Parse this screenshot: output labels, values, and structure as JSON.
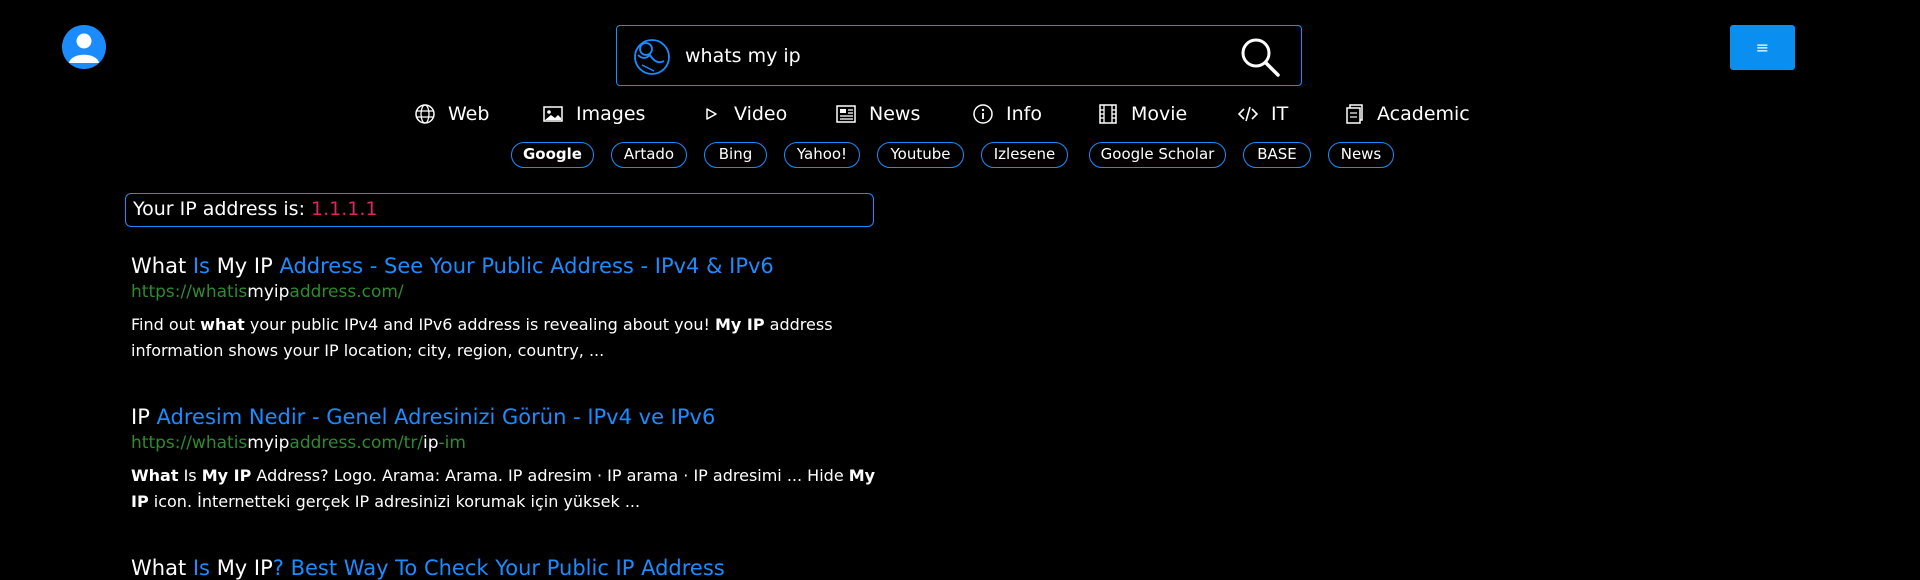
{
  "search": {
    "query": "whats my ip"
  },
  "menu_label": "≡",
  "tabs": [
    {
      "label": "Web",
      "icon": "globe-icon"
    },
    {
      "label": "Images",
      "icon": "image-icon"
    },
    {
      "label": "Video",
      "icon": "play-icon"
    },
    {
      "label": "News",
      "icon": "newspaper-icon"
    },
    {
      "label": "Info",
      "icon": "info-icon"
    },
    {
      "label": "Movie",
      "icon": "film-icon"
    },
    {
      "label": "IT",
      "icon": "code-icon"
    },
    {
      "label": "Academic",
      "icon": "notebook-icon"
    }
  ],
  "engines": [
    {
      "label": "Google",
      "active": true
    },
    {
      "label": "Artado"
    },
    {
      "label": "Bing"
    },
    {
      "label": "Yahoo!"
    },
    {
      "label": "Youtube"
    },
    {
      "label": "Izlesene"
    },
    {
      "label": "Google Scholar"
    },
    {
      "label": "BASE"
    },
    {
      "label": "News"
    }
  ],
  "ip_answer": {
    "label": "Your IP address is:",
    "value": "1.1.1.1"
  },
  "results": [
    {
      "title": {
        "w1": "What",
        "s1": " Is ",
        "w2": "My IP",
        "s2": " Address - See Your Public Address - IPv4 & IPv6"
      },
      "url": {
        "p1": "https://whatis",
        "p2": "myip",
        "p3": "address.com/"
      },
      "snippet": {
        "t1": "Find out ",
        "b1": "what",
        "t2": " your public IPv4 and IPv6 address is revealing about you! ",
        "b2": "My IP",
        "t3": " address information shows your IP location; city, region, country, ..."
      }
    },
    {
      "title": {
        "w1": "IP",
        "s1": " Adresim Nedir - Genel Adresinizi Görün - IPv4 ve IPv6"
      },
      "url": {
        "p1": "https://whatis",
        "p2": "myip",
        "p3": "address.com/tr/",
        "p4": "ip",
        "p5": "-im"
      },
      "snippet": {
        "b1": "What",
        "t1": " Is ",
        "b2": "My IP",
        "t2": " Address? Logo. Arama: Arama. IP adresim · IP arama · IP adresimi ... Hide ",
        "b3": "My IP",
        "t3": " icon. İnternetteki gerçek IP adresinizi korumak için yüksek ..."
      }
    },
    {
      "title": {
        "w1": "What",
        "s1": " Is ",
        "w2": "My IP",
        "s2": "? Best Way To Check Your Public IP Address"
      }
    }
  ],
  "colors": {
    "accent": "#1a8cff",
    "menu_button": "#0a8ff0",
    "ip_value": "#e0245e",
    "url_green": "#2e8b2e",
    "background": "#000000"
  }
}
